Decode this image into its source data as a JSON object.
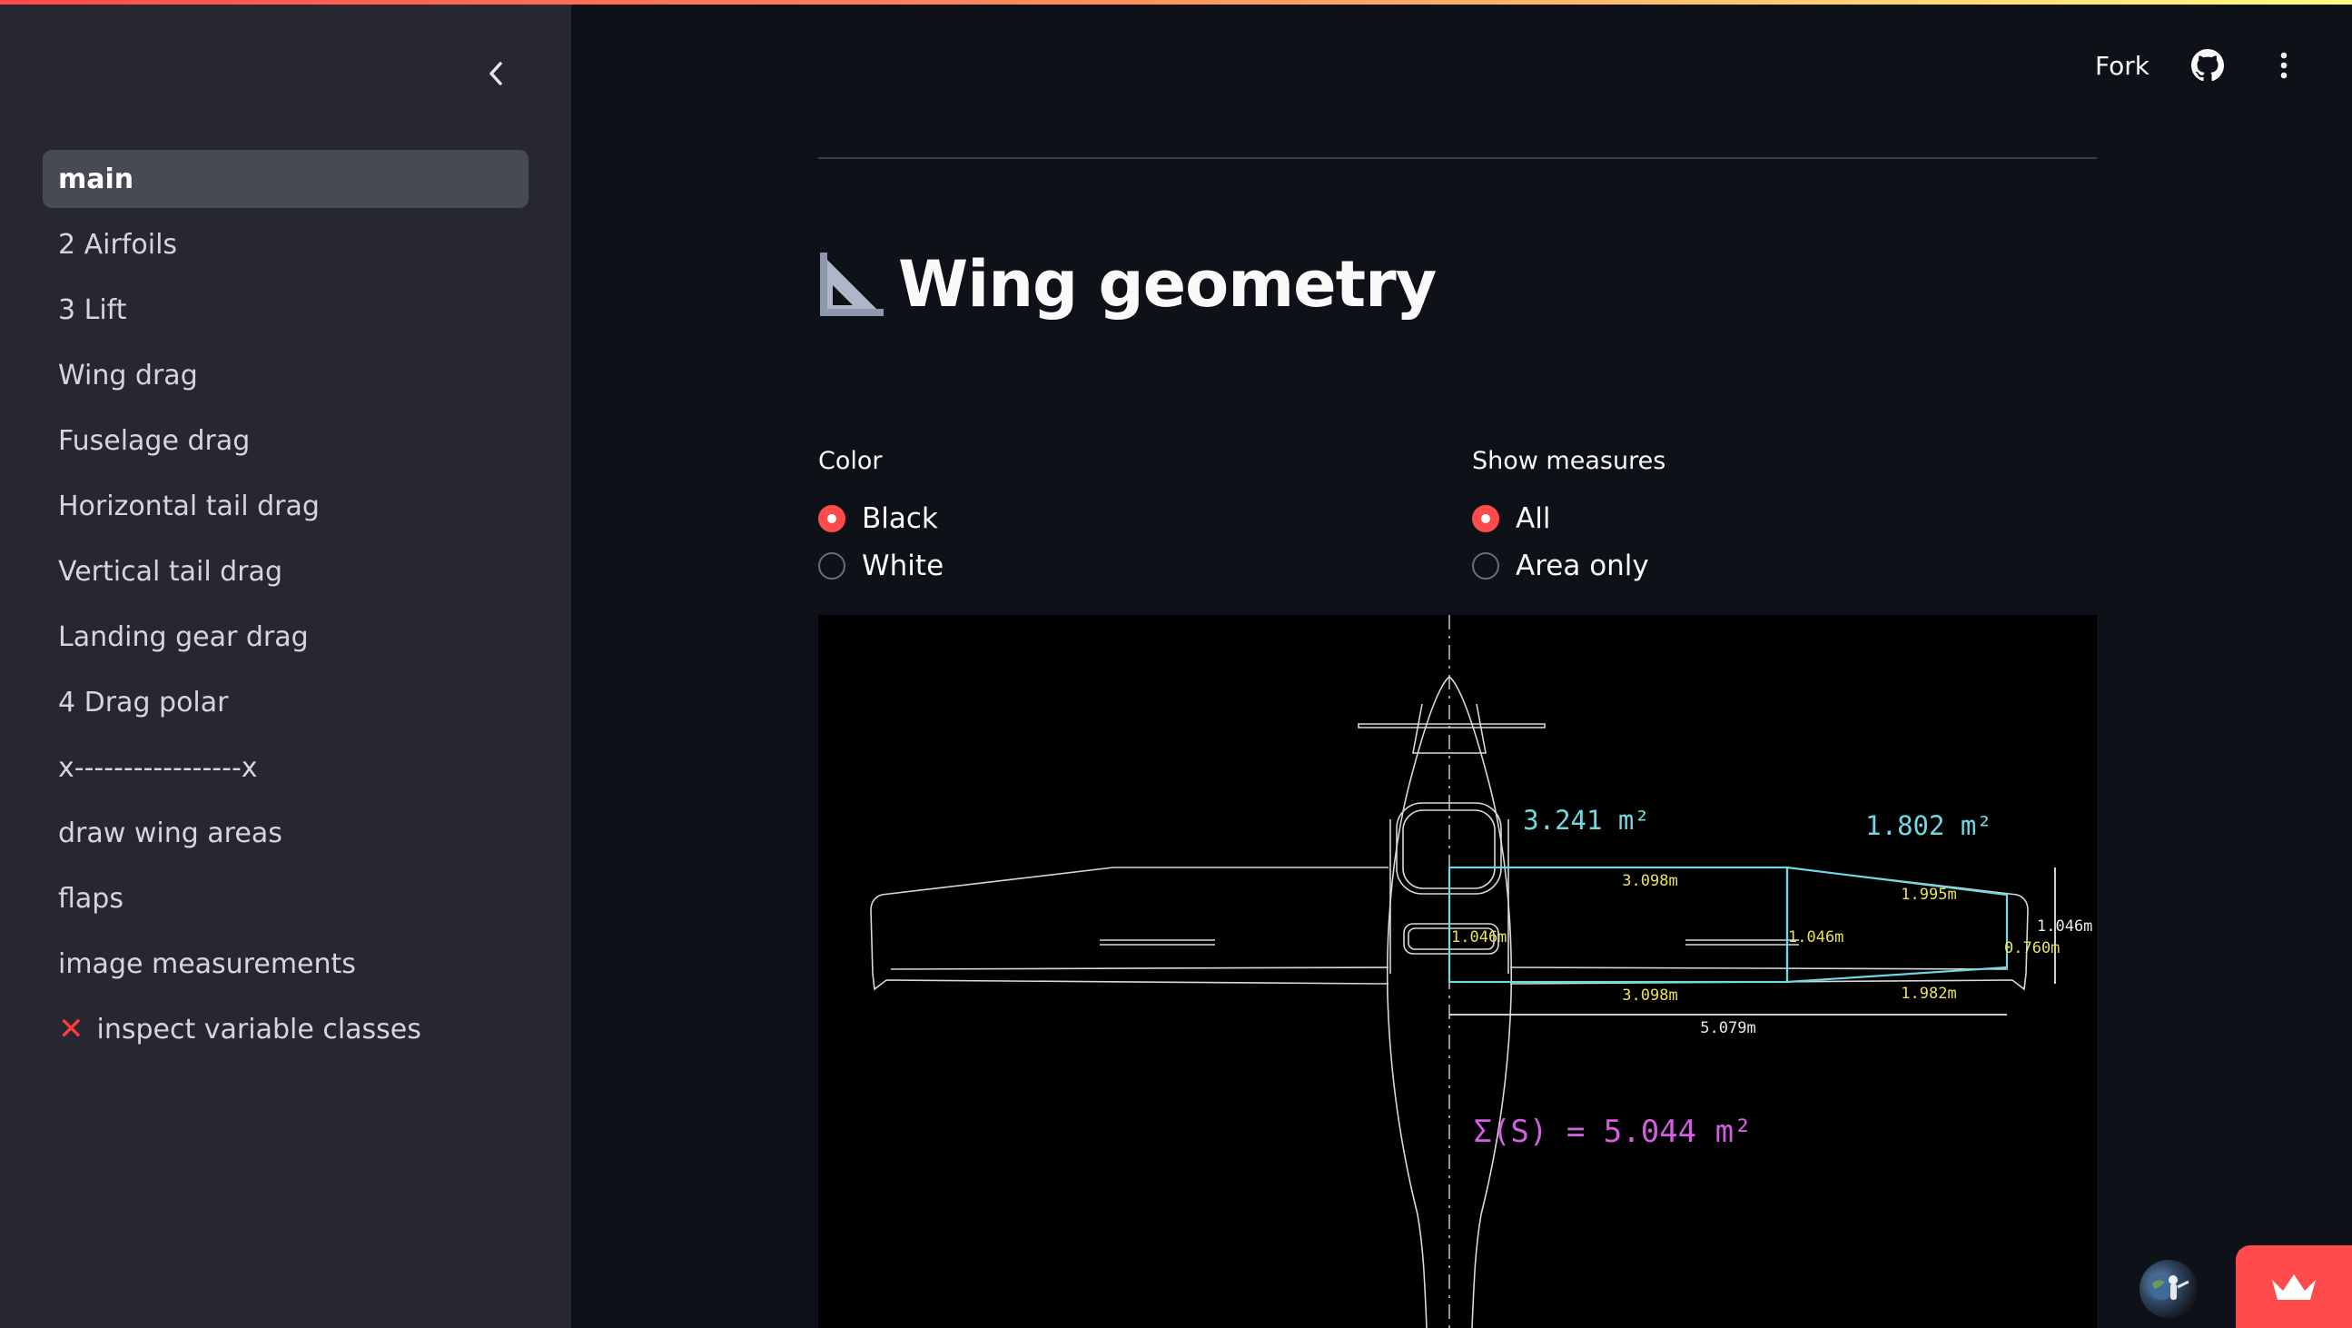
{
  "sidebar": {
    "items": [
      {
        "label": "main",
        "active": true
      },
      {
        "label": "2 Airfoils"
      },
      {
        "label": "3 Lift"
      },
      {
        "label": "Wing drag"
      },
      {
        "label": "Fuselage drag"
      },
      {
        "label": "Horizontal tail drag"
      },
      {
        "label": "Vertical tail drag"
      },
      {
        "label": "Landing gear drag"
      },
      {
        "label": "4 Drag polar"
      },
      {
        "label": "x-----------------x"
      },
      {
        "label": "draw wing areas"
      },
      {
        "label": "flaps"
      },
      {
        "label": "image measurements"
      },
      {
        "label": "inspect variable classes",
        "icon": "red-x-icon"
      }
    ]
  },
  "header": {
    "fork_label": "Fork",
    "icons": [
      "github-icon",
      "more-vertical-icon"
    ]
  },
  "main": {
    "title": "Wing geometry",
    "title_icon": "triangular-ruler-icon",
    "color_radio": {
      "label": "Color",
      "options": [
        "Black",
        "White"
      ],
      "selected": "Black"
    },
    "measures_radio": {
      "label": "Show measures",
      "options": [
        "All",
        "Area only"
      ],
      "selected": "All"
    }
  },
  "drawing": {
    "area_inner": "3.241 m²",
    "area_outer": "1.802 m²",
    "chord_root_top": "3.098m",
    "chord_root_bottom": "3.098m",
    "outer_top": "1.995m",
    "outer_bottom": "1.982m",
    "root_chord": "1.046m",
    "mid_chord": "1.046m",
    "tip_chord": "0.760m",
    "tip_dim": "1.046m",
    "span": "5.079m",
    "total": "Σ(S) = 5.044 m²",
    "colors": {
      "area": "#6fd8e2",
      "measure": "#e8e35a",
      "total": "#d35ee0",
      "outline": "#d8d8d8",
      "span": "#eaeaea"
    }
  },
  "theme": {
    "accent": "#ff4b4b",
    "sidebar_bg": "#262730",
    "main_bg": "#0e1117"
  }
}
